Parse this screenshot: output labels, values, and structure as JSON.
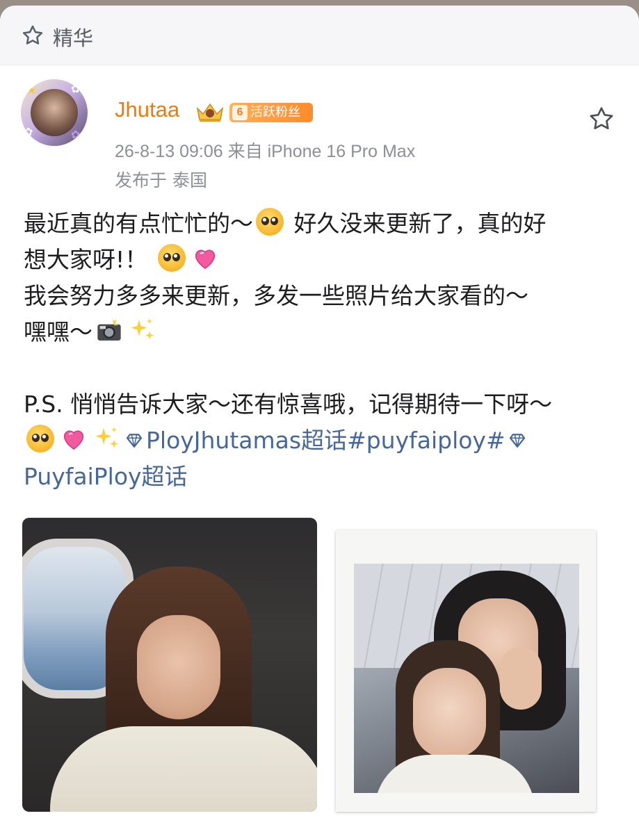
{
  "header": {
    "title": "精华",
    "icon": "star-outline-icon"
  },
  "author": {
    "name": "Jhutaa",
    "crown_icon": "crown-icon",
    "fan_badge": {
      "level": "6",
      "label": "活跃粉丝"
    }
  },
  "meta": {
    "time_and_device": "26-8-13 09:06  来自 iPhone 16 Pro Max",
    "location": "发布于 泰国"
  },
  "post": {
    "line1_a": "最近真的有点忙忙的～",
    "line1_b": " 好久没来更新了，真的好",
    "line2": "想大家呀!！",
    "line3": "我会努力多多来更新，多发一些照片给大家看的～",
    "line4": "嘿嘿～",
    "line5": "P.S. 悄悄告诉大家～还有惊喜哦，记得期待一下呀～",
    "tag1": "PloyJhutamas超话",
    "tag2": "#puyfaiploy#",
    "tag3": "PuyfaiPloy超话"
  },
  "colors": {
    "username": "#f07a10",
    "link": "#45679a",
    "badge": "#ff8a2a"
  }
}
